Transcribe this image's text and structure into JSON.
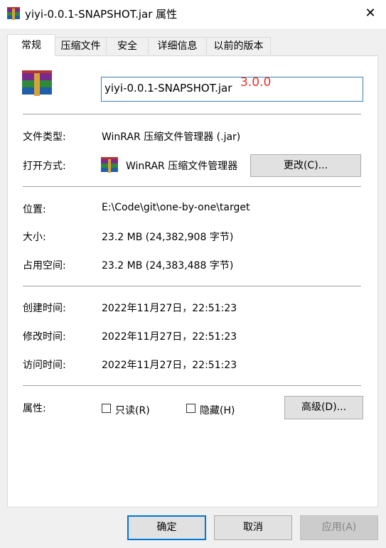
{
  "window": {
    "title": "yiyi-0.0.1-SNAPSHOT.jar 属性",
    "close_glyph": "✕"
  },
  "tabs": [
    {
      "label": "常规",
      "active": true
    },
    {
      "label": "压缩文件"
    },
    {
      "label": "安全"
    },
    {
      "label": "详细信息"
    },
    {
      "label": "以前的版本"
    }
  ],
  "general": {
    "filename": "yiyi-0.0.1-SNAPSHOT.jar",
    "annotation": "3.0.0",
    "annotation_color": "#e8302a",
    "rows": {
      "type_label": "文件类型:",
      "type_value": "WinRAR 压缩文件管理器 (.jar)",
      "open_label": "打开方式:",
      "open_value": "WinRAR 压缩文件管理器",
      "change_button": "更改(C)...",
      "location_label": "位置:",
      "location_value": "E:\\Code\\git\\one-by-one\\target",
      "size_label": "大小:",
      "size_value": "23.2 MB (24,382,908 字节)",
      "disk_label": "占用空间:",
      "disk_value": "23.2 MB (24,383,488 字节)",
      "created_label": "创建时间:",
      "created_value": "2022年11月27日，22:51:23",
      "modified_label": "修改时间:",
      "modified_value": "2022年11月27日，22:51:23",
      "accessed_label": "访问时间:",
      "accessed_value": "2022年11月27日，22:51:23",
      "attributes_label": "属性:",
      "readonly_label": "只读(R)",
      "hidden_label": "隐藏(H)",
      "advanced_button": "高级(D)..."
    }
  },
  "footer": {
    "ok": "确定",
    "cancel": "取消",
    "apply": "应用(A)"
  },
  "colors": {
    "focus_border": "#0078d7",
    "field_border": "#3c7fb1",
    "disabled_text": "#838383"
  },
  "icons": {
    "app": "winrar-archive-icon"
  }
}
